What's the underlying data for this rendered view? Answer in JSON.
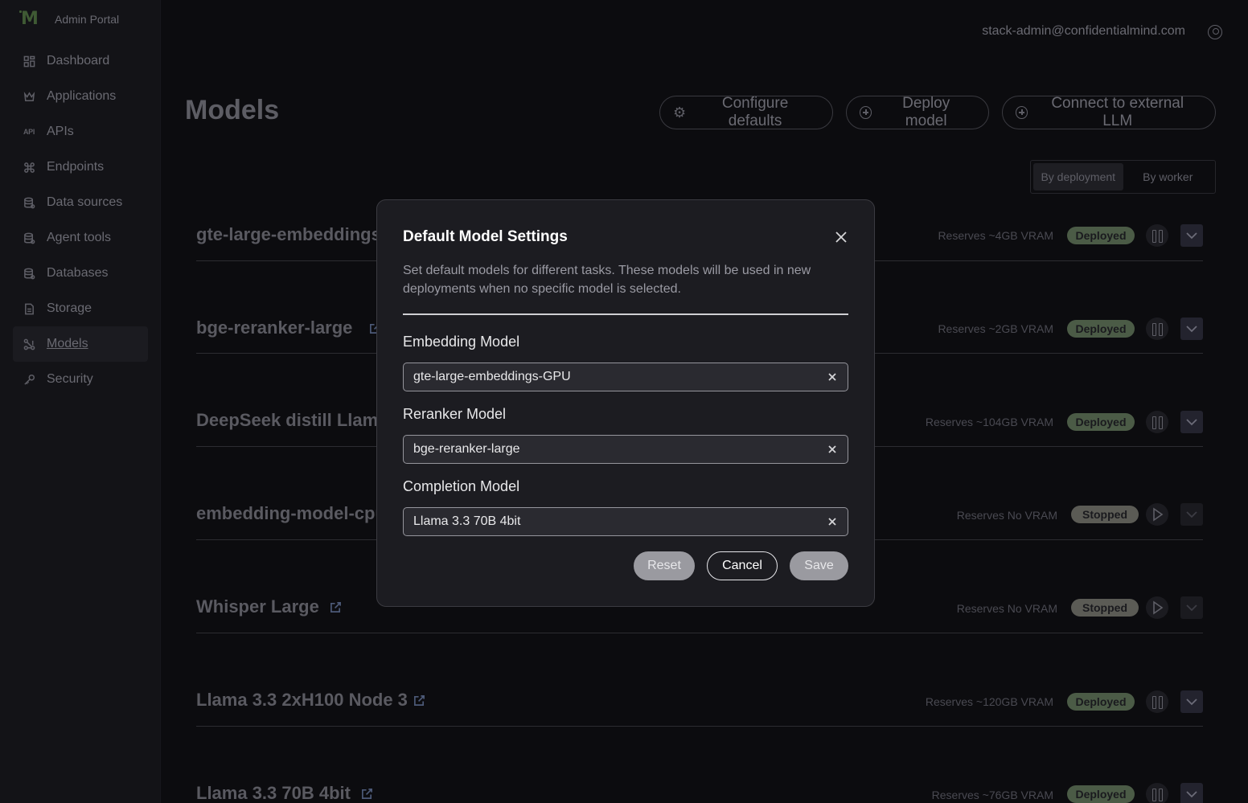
{
  "brand": {
    "name": "Admin Portal"
  },
  "sidebar": {
    "items": [
      {
        "label": "Dashboard",
        "icon": "grid-icon"
      },
      {
        "label": "Applications",
        "icon": "crown-icon"
      },
      {
        "label": "APIs",
        "icon": "api-icon",
        "icon_text": "API"
      },
      {
        "label": "Endpoints",
        "icon": "command-icon"
      },
      {
        "label": "Data sources",
        "icon": "database-icon"
      },
      {
        "label": "Agent tools",
        "icon": "database-icon"
      },
      {
        "label": "Databases",
        "icon": "database-icon"
      },
      {
        "label": "Storage",
        "icon": "file-icon"
      },
      {
        "label": "Models",
        "icon": "models-icon",
        "active": true
      },
      {
        "label": "Security",
        "icon": "key-icon"
      }
    ]
  },
  "header": {
    "user_email": "stack-admin@confidentialmind.com"
  },
  "page": {
    "title": "Models",
    "buttons": {
      "configure": "Configure defaults",
      "deploy": "Deploy model",
      "connect": "Connect to external LLM"
    },
    "view_toggle": {
      "by_deployment": "By deployment",
      "by_worker": "By worker"
    }
  },
  "models": [
    {
      "name": "gte-large-embeddings",
      "vram": "Reserves ~4GB VRAM",
      "status": "Deployed"
    },
    {
      "name": "bge-reranker-large",
      "vram": "Reserves ~2GB VRAM",
      "status": "Deployed"
    },
    {
      "name": "DeepSeek distill Llama",
      "vram": "Reserves ~104GB VRAM",
      "status": "Deployed"
    },
    {
      "name": "embedding-model-cpu",
      "vram": "Reserves No VRAM",
      "status": "Stopped"
    },
    {
      "name": "Whisper Large",
      "vram": "Reserves No VRAM",
      "status": "Stopped"
    },
    {
      "name": "Llama 3.3 2xH100 Node 3",
      "vram": "Reserves ~120GB VRAM",
      "status": "Deployed"
    },
    {
      "name": "Llama 3.3 70B 4bit",
      "vram": "Reserves ~76GB VRAM",
      "status": "Deployed"
    }
  ],
  "modal": {
    "title": "Default Model Settings",
    "description": "Set default models for different tasks. These models will be used in new deployments when no specific model is selected.",
    "fields": [
      {
        "label": "Embedding Model",
        "value": "gte-large-embeddings-GPU"
      },
      {
        "label": "Reranker Model",
        "value": "bge-reranker-large"
      },
      {
        "label": "Completion Model",
        "value": "Llama 3.3 70B 4bit"
      }
    ],
    "buttons": {
      "reset": "Reset",
      "cancel": "Cancel",
      "save": "Save"
    }
  },
  "colors": {
    "background": "#0c0c0f",
    "sidebar": "#131317",
    "deployed_badge": "#4b5b46",
    "stopped_badge": "#5b5b55",
    "modal_bg": "#1c1c21"
  }
}
